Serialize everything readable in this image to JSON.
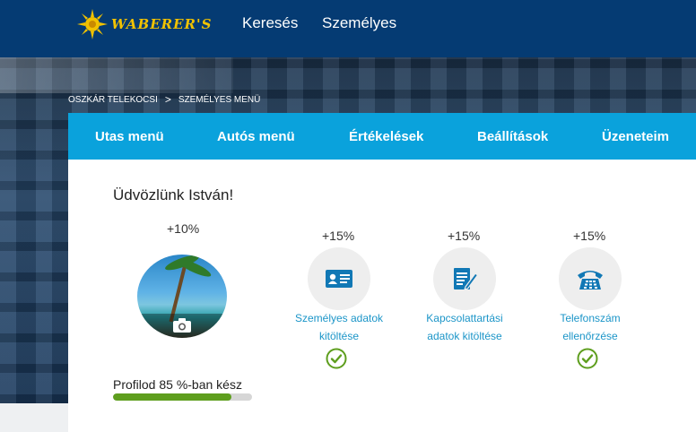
{
  "header": {
    "logo_text": "WABERER'S",
    "nav": [
      "Keresés",
      "Személyes"
    ]
  },
  "breadcrumb": [
    "OSZKÁR TELEKOCSI",
    "SZEMÉLYES MENÜ"
  ],
  "tabs": [
    "Utas menü",
    "Autós menü",
    "Értékelések",
    "Beállítások",
    "Üzeneteim"
  ],
  "main": {
    "welcome": "Üdvözlünk István!",
    "avatar_bonus": "+10%",
    "steps": [
      {
        "bonus": "+15%",
        "label_line1": "Személyes adatok",
        "label_line2": "kitöltése",
        "icon": "id-card-icon",
        "done": true
      },
      {
        "bonus": "+15%",
        "label_line1": "Kapcsolattartási",
        "label_line2": "adatok kitöltése",
        "icon": "form-edit-icon",
        "done": false
      },
      {
        "bonus": "+15%",
        "label_line1": "Telefonszám",
        "label_line2": "ellenőrzése",
        "icon": "telephone-icon",
        "done": true
      }
    ],
    "profile_text": "Profilod 85 %-ban kész",
    "profile_progress": 0.85
  },
  "colors": {
    "topbar": "#053b73",
    "tabs": "#0aa2dc",
    "accent_text": "#1b95c8",
    "check": "#5e9e1e",
    "icon": "#1178b5"
  }
}
